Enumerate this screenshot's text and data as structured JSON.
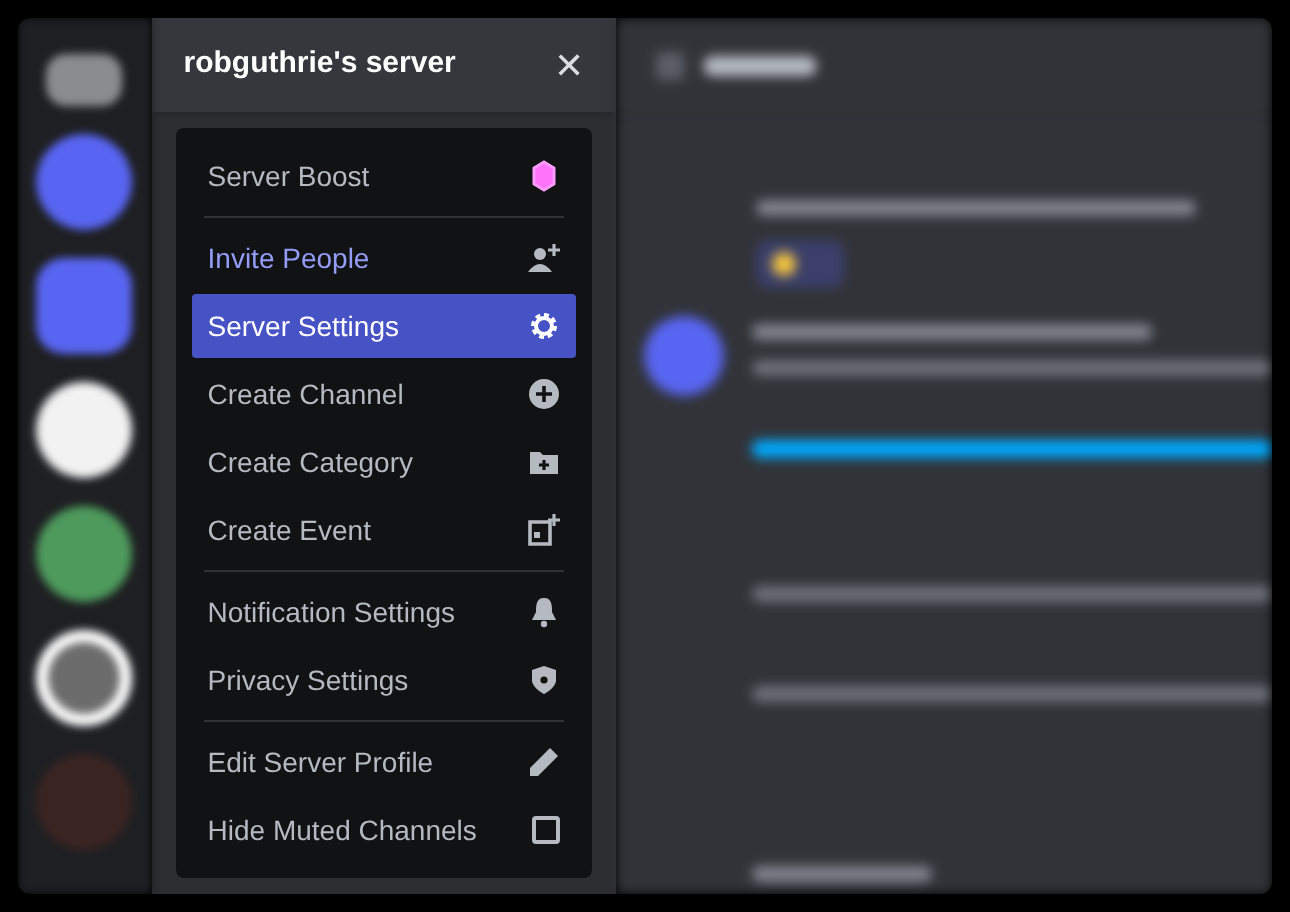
{
  "sidebar": {
    "server_name": "robguthrie's server",
    "close": "✕"
  },
  "menu": {
    "groups": [
      {
        "items": [
          {
            "kind": "item",
            "label": "Server Boost",
            "selected": false,
            "color": "#b5bac1"
          }
        ]
      },
      {
        "items": [
          {
            "kind": "item",
            "label": "Invite People",
            "selected": false,
            "color": "#949cf7"
          },
          {
            "kind": "item",
            "label": "Server Settings",
            "selected": true,
            "color": "#ffffff"
          },
          {
            "kind": "item",
            "label": "Create Channel",
            "selected": false,
            "color": "#b5bac1"
          },
          {
            "kind": "item",
            "label": "Create Category",
            "selected": false,
            "color": "#b5bac1"
          },
          {
            "kind": "item",
            "label": "Create Event",
            "selected": false,
            "color": "#b5bac1"
          }
        ]
      },
      {
        "items": [
          {
            "kind": "item",
            "label": "Notification Settings",
            "selected": false,
            "color": "#b5bac1"
          },
          {
            "kind": "item",
            "label": "Privacy Settings",
            "selected": false,
            "color": "#b5bac1"
          }
        ]
      },
      {
        "items": [
          {
            "kind": "item",
            "label": "Edit Server Profile",
            "selected": false,
            "color": "#b5bac1"
          },
          {
            "kind": "checkbox",
            "label": "Hide Muted Channels",
            "selected": false,
            "checked": false,
            "color": "#b5bac1"
          }
        ]
      }
    ]
  }
}
